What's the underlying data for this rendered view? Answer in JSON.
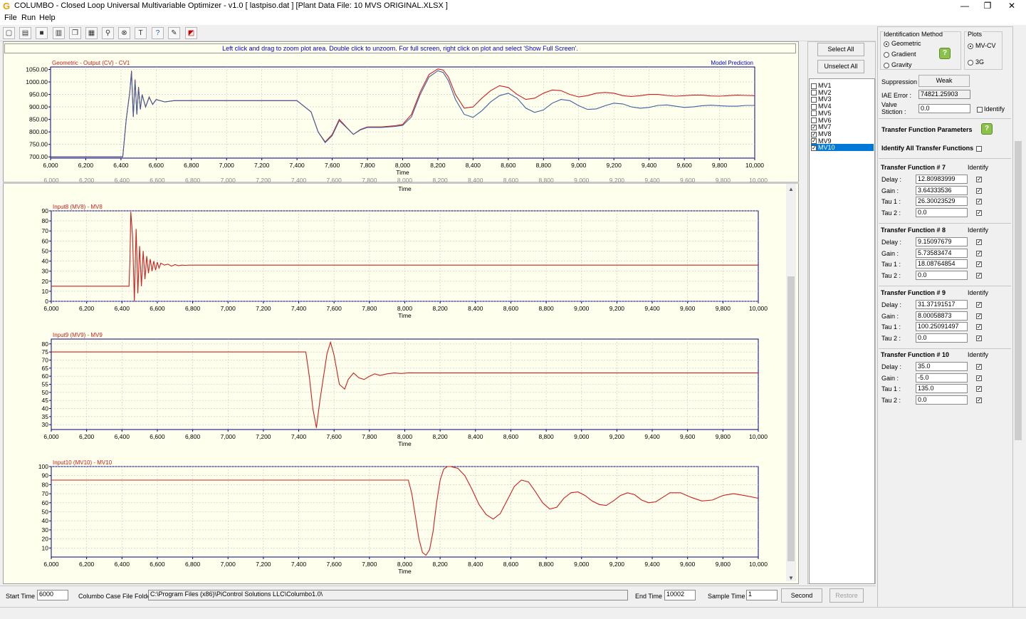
{
  "window": {
    "title": "COLUMBO - Closed Loop Universal Multivariable Optimizer - v1.0   [ lastpiso.dat ]  [Plant Data File: 10 MVS ORIGINAL.XLSX ]",
    "icon": "columbo-logo-icon",
    "minimize": "—",
    "maximize": "❐",
    "close": "✕"
  },
  "menu": {
    "file": "File",
    "run": "Run",
    "help": "Help"
  },
  "toolbar": {
    "icons": [
      "new-icon",
      "open-icon",
      "save-icon",
      "print-icon",
      "copy-icon",
      "grid-icon",
      "zoom-icon",
      "stop-icon",
      "text-icon",
      "help-icon",
      "pen-icon",
      "chart-icon"
    ]
  },
  "hint": "Left click and drag to zoom plot area. Double click to unzoom. For full screen, right click on plot and select 'Show Full Screen'.",
  "colors": {
    "red": "#cc2020",
    "blue": "#4060a0",
    "axis": "#000080",
    "plot_bg": "#ffffee"
  },
  "chart_data": [
    {
      "type": "line",
      "title": "Geometric - Output (CV) - CV1",
      "legend": "Model Prediction",
      "xlabel": "Time",
      "ylim": [
        695,
        1060
      ],
      "yticks": [
        "1050.00",
        "1000.00",
        "950.00",
        "900.00",
        "850.00",
        "800.00",
        "750.00",
        "700.00"
      ],
      "xticks": [
        "6,000",
        "6,200",
        "6,400",
        "6,600",
        "6,800",
        "7,000",
        "7,200",
        "7,400",
        "7,600",
        "7,800",
        "8,000",
        "8,200",
        "8,400",
        "8,600",
        "8,800",
        "9,000",
        "9,200",
        "9,400",
        "9,600",
        "9,800",
        "10,000"
      ],
      "series": [
        {
          "name": "",
          "color": "#cc2020",
          "x": [
            6000,
            6410,
            6430,
            6450,
            6460,
            6470,
            6480,
            6490,
            6500,
            6510,
            6520,
            6540,
            6560,
            6580,
            6600,
            6650,
            6700,
            6800,
            6900,
            7000,
            7200,
            7400,
            7480,
            7520,
            7560,
            7600,
            7640,
            7680,
            7720,
            7760,
            7800,
            7880,
            7960,
            8000,
            8050,
            8100,
            8150,
            8200,
            8230,
            8260,
            8300,
            8350,
            8400,
            8450,
            8500,
            8550,
            8600,
            8650,
            8700,
            8750,
            8800,
            8850,
            8900,
            8950,
            9000,
            9050,
            9100,
            9150,
            9200,
            9250,
            9300,
            9350,
            9400,
            9450,
            9500,
            9550,
            9600,
            9650,
            9700,
            9750,
            9800,
            9850,
            9900,
            9950,
            10000
          ],
          "values": [
            700,
            700,
            850,
            960,
            1045,
            860,
            1010,
            870,
            980,
            890,
            950,
            900,
            940,
            910,
            930,
            920,
            925,
            925,
            925,
            925,
            925,
            925,
            880,
            800,
            760,
            790,
            850,
            820,
            790,
            810,
            820,
            820,
            825,
            830,
            870,
            960,
            1030,
            1052,
            1048,
            1020,
            950,
            895,
            900,
            935,
            965,
            985,
            978,
            950,
            930,
            935,
            955,
            968,
            965,
            950,
            940,
            945,
            955,
            958,
            955,
            945,
            942,
            945,
            950,
            950,
            946,
            943,
            945,
            947,
            947,
            944,
            943,
            945,
            947,
            946,
            945
          ]
        },
        {
          "name": "",
          "color": "#4060a0",
          "x": [
            6000,
            6410,
            6430,
            6450,
            6460,
            6470,
            6480,
            6490,
            6500,
            6510,
            6520,
            6540,
            6560,
            6580,
            6600,
            6650,
            6700,
            6800,
            6900,
            7000,
            7200,
            7400,
            7480,
            7520,
            7560,
            7600,
            7640,
            7680,
            7720,
            7760,
            7800,
            7880,
            7960,
            8000,
            8050,
            8100,
            8150,
            8200,
            8230,
            8260,
            8300,
            8350,
            8400,
            8450,
            8500,
            8550,
            8600,
            8650,
            8700,
            8750,
            8800,
            8850,
            8900,
            8950,
            9000,
            9050,
            9100,
            9150,
            9200,
            9250,
            9300,
            9350,
            9400,
            9450,
            9500,
            9550,
            9600,
            9650,
            9700,
            9750,
            9800,
            9850,
            9900,
            9950,
            10000
          ],
          "values": [
            700,
            700,
            850,
            960,
            1040,
            860,
            1005,
            870,
            975,
            890,
            948,
            900,
            938,
            910,
            929,
            920,
            925,
            925,
            925,
            925,
            925,
            925,
            880,
            800,
            757,
            785,
            845,
            818,
            790,
            808,
            818,
            818,
            822,
            826,
            860,
            950,
            1020,
            1045,
            1038,
            1005,
            930,
            870,
            858,
            885,
            920,
            945,
            955,
            935,
            895,
            878,
            888,
            915,
            930,
            925,
            905,
            890,
            892,
            905,
            915,
            912,
            900,
            895,
            898,
            906,
            908,
            903,
            898,
            900,
            905,
            907,
            905,
            903,
            903,
            906,
            906
          ]
        }
      ]
    },
    {
      "type": "line",
      "title": "Input8 (MV8) - MV8",
      "xlabel": "Time",
      "ylim": [
        0,
        90
      ],
      "yticks": [
        "90",
        "80",
        "70",
        "60",
        "50",
        "40",
        "30",
        "20",
        "10",
        "0"
      ],
      "xticks": [
        "6,000",
        "6,200",
        "6,400",
        "6,600",
        "6,800",
        "7,000",
        "7,200",
        "7,400",
        "7,600",
        "7,800",
        "8,000",
        "8,200",
        "8,400",
        "8,600",
        "8,800",
        "9,000",
        "9,200",
        "9,400",
        "9,600",
        "9,800",
        "10,000"
      ],
      "series": [
        {
          "name": "",
          "color": "#cc2020",
          "x": [
            6000,
            6440,
            6445,
            6450,
            6460,
            6470,
            6480,
            6490,
            6500,
            6510,
            6520,
            6530,
            6540,
            6550,
            6560,
            6570,
            6580,
            6590,
            6600,
            6610,
            6620,
            6640,
            6660,
            6680,
            6700,
            6720,
            6740,
            6760,
            6780,
            6800,
            6900,
            7000,
            8000,
            10000
          ],
          "values": [
            15,
            15,
            40,
            89,
            65,
            0,
            72,
            8,
            55,
            15,
            50,
            22,
            45,
            28,
            42,
            30,
            40,
            31,
            39,
            33,
            38,
            36,
            37,
            35,
            36.5,
            35.5,
            36,
            35.8,
            36,
            36,
            36,
            36,
            36,
            36
          ]
        }
      ]
    },
    {
      "type": "line",
      "title": "Input9 (MV9) - MV9",
      "xlabel": "Time",
      "ylim": [
        27,
        83
      ],
      "yticks": [
        "80",
        "75",
        "70",
        "65",
        "60",
        "55",
        "50",
        "45",
        "40",
        "35",
        "30"
      ],
      "xticks": [
        "6,000",
        "6,200",
        "6,400",
        "6,600",
        "6,800",
        "7,000",
        "7,200",
        "7,400",
        "7,600",
        "7,800",
        "8,000",
        "8,200",
        "8,400",
        "8,600",
        "8,800",
        "9,000",
        "9,200",
        "9,400",
        "9,600",
        "9,800",
        "10,000"
      ],
      "series": [
        {
          "name": "",
          "color": "#cc2020",
          "x": [
            6000,
            7440,
            7460,
            7480,
            7500,
            7520,
            7560,
            7580,
            7600,
            7630,
            7660,
            7680,
            7710,
            7740,
            7770,
            7800,
            7830,
            7860,
            7900,
            7940,
            7980,
            8020,
            8060,
            8100,
            8200,
            8400,
            10000
          ],
          "values": [
            75,
            75,
            60,
            40,
            28,
            45,
            74,
            81,
            73,
            55,
            52,
            58,
            62,
            59,
            58,
            60,
            61.5,
            60.5,
            61.5,
            62,
            61.7,
            62.1,
            62,
            62,
            62,
            62,
            62
          ]
        }
      ]
    },
    {
      "type": "line",
      "title": "Input10 (MV10) - MV10",
      "xlabel": "Time",
      "ylim": [
        0,
        100
      ],
      "yticks": [
        "100",
        "90",
        "80",
        "70",
        "60",
        "50",
        "40",
        "30",
        "20",
        "10"
      ],
      "xticks": [
        "6,000",
        "6,200",
        "6,400",
        "6,600",
        "6,800",
        "7,000",
        "7,200",
        "7,400",
        "7,600",
        "7,800",
        "8,000",
        "8,200",
        "8,400",
        "8,600",
        "8,800",
        "9,000",
        "9,200",
        "9,400",
        "9,600",
        "9,800",
        "10,000"
      ],
      "series": [
        {
          "name": "",
          "color": "#cc2020",
          "x": [
            6000,
            8020,
            8040,
            8060,
            8080,
            8100,
            8120,
            8140,
            8160,
            8180,
            8200,
            8220,
            8240,
            8260,
            8300,
            8340,
            8380,
            8420,
            8460,
            8500,
            8540,
            8580,
            8620,
            8660,
            8700,
            8740,
            8780,
            8820,
            8860,
            8900,
            8940,
            8980,
            9020,
            9060,
            9100,
            9140,
            9180,
            9220,
            9260,
            9300,
            9340,
            9380,
            9420,
            9460,
            9500,
            9560,
            9620,
            9680,
            9740,
            9800,
            9860,
            9920,
            10000
          ],
          "values": [
            85,
            85,
            70,
            45,
            20,
            5,
            2,
            8,
            28,
            60,
            85,
            97,
            100,
            100,
            98,
            90,
            75,
            58,
            47,
            42,
            48,
            63,
            78,
            85,
            83,
            72,
            60,
            53,
            55,
            65,
            71,
            72,
            68,
            62,
            58,
            57,
            62,
            68,
            71,
            69,
            63,
            60,
            61,
            66,
            71,
            71,
            66,
            62,
            63,
            68,
            70,
            68,
            65
          ]
        }
      ]
    }
  ],
  "right_list": {
    "select_all": "Select All",
    "unselect_all": "Unselect All",
    "items": [
      "MV1",
      "MV2",
      "MV3",
      "MV4",
      "MV5",
      "MV6",
      "MV7",
      "MV8",
      "MV9",
      "MV10"
    ],
    "checked": [
      false,
      false,
      false,
      false,
      false,
      false,
      true,
      true,
      true,
      true
    ],
    "check_mark": "✓"
  },
  "params": {
    "ident_method_label": "Identification Method",
    "method_geometric": "Geometric",
    "method_gradient": "Gradient",
    "method_gravity": "Gravity",
    "plots_label": "Plots",
    "plot_mvcv": "MV-CV",
    "plot_3g": "3G",
    "suppression_label": "Suppression :",
    "suppression_value": "Weak",
    "iae_label": "IAE Error :",
    "iae_value": "74821.25903",
    "valve_label_1": "Valve",
    "valve_label_2": "Stiction :",
    "valve_value": "0.0",
    "identify_label": "Identify",
    "tfp_label": "Transfer Function Parameters",
    "identify_all_label": "Identify All Transfer Functions",
    "help_glyph": "?",
    "functions": [
      {
        "title": "Transfer Function # 7",
        "delay": "12.80983999",
        "gain": "3.64333536",
        "tau1": "26.30023529",
        "tau2": "0.0"
      },
      {
        "title": "Transfer Function # 8",
        "delay": "9.15097679",
        "gain": "5.73583474",
        "tau1": "18.08764854",
        "tau2": "0.0"
      },
      {
        "title": "Transfer Function # 9",
        "delay": "31.37191517",
        "gain": "8.00058873",
        "tau1": "100.25091497",
        "tau2": "0.0"
      },
      {
        "title": "Transfer Function # 10",
        "delay": "35.0",
        "gain": "-5.0",
        "tau1": "135.0",
        "tau2": "0.0"
      }
    ],
    "delay_label": "Delay :",
    "gain_label": "Gain :",
    "tau1_label": "Tau 1 :",
    "tau2_label": "Tau 2 :"
  },
  "bottom": {
    "start_label": "Start Time :",
    "start_value": "6000",
    "folder_label": "Columbo Case File Folder:",
    "folder_value": "C:\\Program Files (x86)\\PiControl Solutions LLC\\Columbo1.0\\",
    "end_label": "End Time :",
    "end_value": "10002",
    "sample_label": "Sample Time :",
    "sample_value": "1",
    "unit": "Second",
    "restore": "Restore"
  }
}
